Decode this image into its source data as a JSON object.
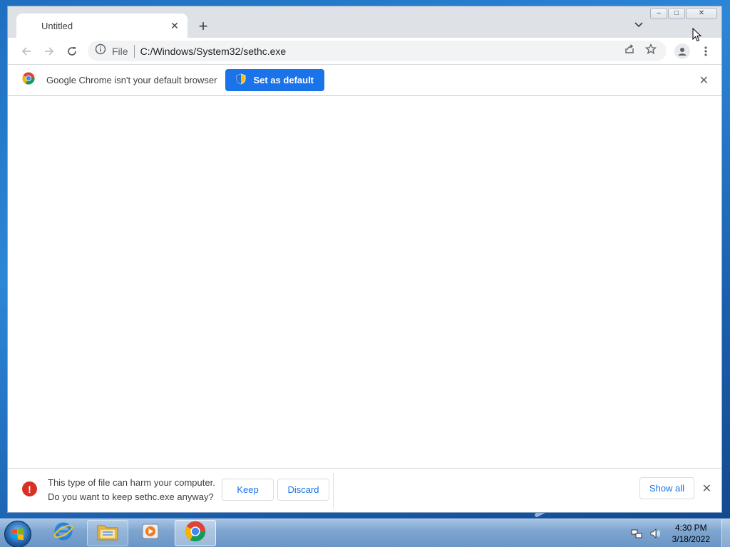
{
  "browser": {
    "tab": {
      "title": "Untitled"
    },
    "address": {
      "scheme": "File",
      "url": "C:/Windows/System32/sethc.exe"
    },
    "infobar": {
      "message": "Google Chrome isn't your default browser",
      "button_label": "Set as default"
    },
    "download_shelf": {
      "warning_line1": "This type of file can harm your computer.",
      "warning_line2": "Do you want to keep sethc.exe anyway?",
      "keep_label": "Keep",
      "discard_label": "Discard",
      "show_all_label": "Show all"
    },
    "colors": {
      "accent": "#1a73e8",
      "warning": "#d93025"
    }
  },
  "taskbar": {
    "clock_time": "4:30 PM",
    "clock_date": "3/18/2022",
    "items": [
      "internet-explorer-icon",
      "windows-explorer-icon",
      "media-player-icon",
      "chrome-icon"
    ]
  }
}
